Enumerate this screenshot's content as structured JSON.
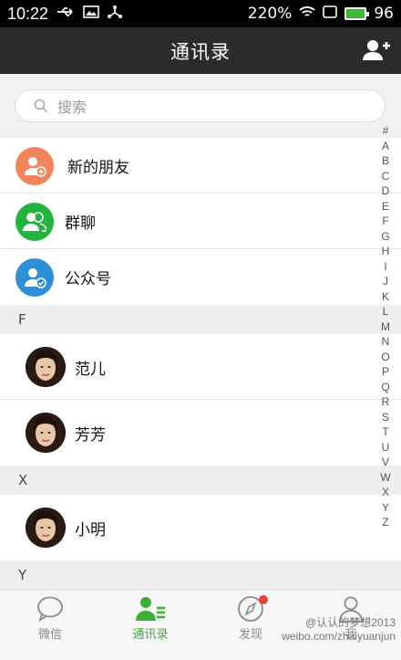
{
  "status_bar": {
    "time": "10:22",
    "signal_text": "220%",
    "battery_level": "96"
  },
  "header": {
    "title": "通讯录"
  },
  "search": {
    "placeholder": "搜索"
  },
  "specials": [
    {
      "label": "新的朋友",
      "icon": "add-friend-icon",
      "color": "#f2845c"
    },
    {
      "label": "群聊",
      "icon": "group-chat-icon",
      "color": "#22b43e"
    },
    {
      "label": "公众号",
      "icon": "official-account-icon",
      "color": "#2d8fd6"
    }
  ],
  "sections": [
    {
      "letter": "F",
      "contacts": [
        "范儿",
        "芳芳"
      ]
    },
    {
      "letter": "X",
      "contacts": [
        "小明"
      ]
    },
    {
      "letter": "Y",
      "contacts": []
    }
  ],
  "index_letters": [
    "#",
    "A",
    "B",
    "C",
    "D",
    "E",
    "F",
    "G",
    "H",
    "I",
    "J",
    "K",
    "L",
    "M",
    "N",
    "O",
    "P",
    "Q",
    "R",
    "S",
    "T",
    "U",
    "V",
    "W",
    "X",
    "Y",
    "Z"
  ],
  "tabs": [
    {
      "label": "微信",
      "icon": "chat-bubble-icon",
      "active": false
    },
    {
      "label": "通讯录",
      "icon": "contacts-icon",
      "active": true
    },
    {
      "label": "发现",
      "icon": "compass-icon",
      "active": false
    },
    {
      "label": "我",
      "icon": "me-icon",
      "active": false
    }
  ],
  "watermark": {
    "line1": "@认认的梦想2013",
    "line2": "weibo.com/zhaiyuanjun"
  },
  "colors": {
    "accent_green": "#3cb034",
    "title_bar": "#2b2b2d"
  }
}
